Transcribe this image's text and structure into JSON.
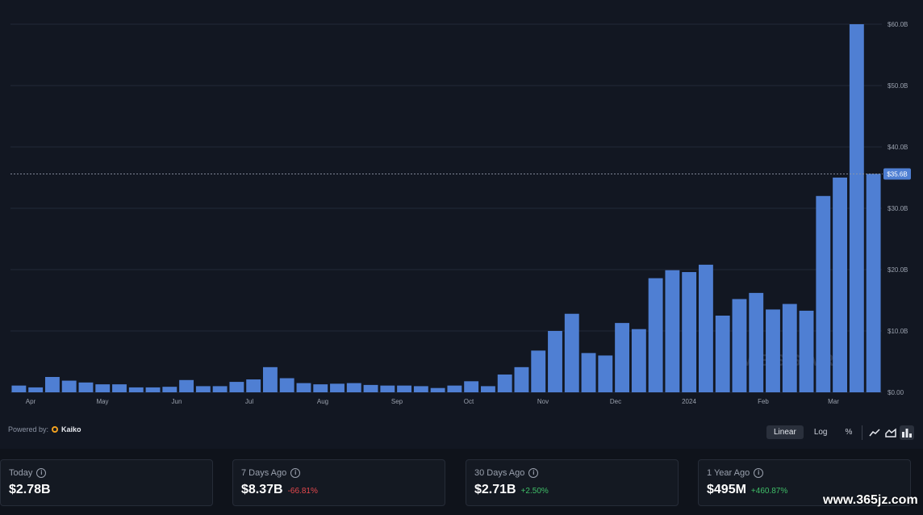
{
  "chart_data": {
    "type": "bar",
    "x_ticks": [
      "Apr",
      "May",
      "Jun",
      "Jul",
      "Aug",
      "Sep",
      "Oct",
      "Nov",
      "Dec",
      "2024",
      "Feb",
      "Mar"
    ],
    "y_ticks": [
      "$0.00",
      "$10.0B",
      "$20.0B",
      "$30.0B",
      "$40.0B",
      "$50.0B",
      "$60.0B"
    ],
    "ylim": [
      0,
      60
    ],
    "y_unit": "B",
    "values": [
      1.1,
      0.8,
      2.5,
      1.9,
      1.6,
      1.3,
      1.3,
      0.8,
      0.8,
      0.9,
      2.0,
      1.0,
      1.0,
      1.7,
      2.1,
      4.1,
      2.3,
      1.5,
      1.3,
      1.4,
      1.5,
      1.2,
      1.1,
      1.1,
      1.0,
      0.7,
      1.1,
      1.8,
      1.0,
      2.9,
      4.1,
      6.8,
      10.0,
      12.8,
      6.4,
      6.0,
      11.3,
      10.3,
      18.6,
      19.9,
      19.6,
      20.8,
      12.5,
      15.2,
      16.2,
      13.5,
      14.4,
      13.3,
      32.0,
      35.0,
      60.0,
      35.6
    ],
    "current_value_label": "$35.6B",
    "current_value": 35.6,
    "grid": true,
    "bar_color": "#4f7fd3",
    "scale_options": [
      "Linear",
      "Log",
      "%"
    ],
    "active_scale": "Linear"
  },
  "watermark_logo": "MESSARI",
  "powered_by": {
    "label": "Powered by:",
    "provider": "Kaiko"
  },
  "stats": [
    {
      "label": "Today",
      "value": "$2.78B",
      "change": ""
    },
    {
      "label": "7 Days Ago",
      "value": "$8.37B",
      "change": "-66.81%"
    },
    {
      "label": "30 Days Ago",
      "value": "$2.71B",
      "change": "+2.50%"
    },
    {
      "label": "1 Year Ago",
      "value": "$495M",
      "change": "+460.87%"
    }
  ],
  "site_watermark": "www.365jz.com",
  "colors": {
    "negative": "#e5484d",
    "positive": "#3fbf68",
    "bar": "#4f7fd3",
    "background": "#121722"
  }
}
